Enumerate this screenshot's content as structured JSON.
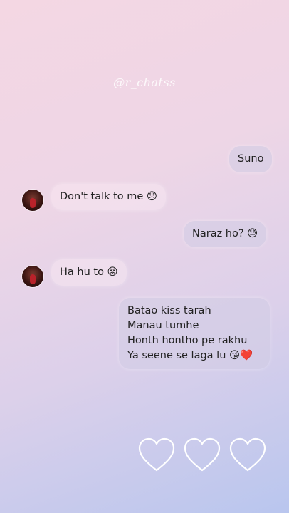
{
  "watermark": "@r_chatss",
  "messages": [
    {
      "from": "sent",
      "text": "Suno"
    },
    {
      "from": "received",
      "text": "Don't talk to me 😞"
    },
    {
      "from": "sent",
      "text": "Naraz ho? 😓"
    },
    {
      "from": "received",
      "text": "Ha hu to 😡"
    },
    {
      "from": "sent",
      "lines": [
        "Batao kiss tarah",
        "Manau tumhe",
        "Honth hontho pe rakhu",
        "Ya seene se laga lu 😘❤️"
      ]
    }
  ],
  "hearts_count": 3,
  "colors": {
    "heart_stroke": "#ffffff",
    "avatar_accent": "#b8222a"
  }
}
